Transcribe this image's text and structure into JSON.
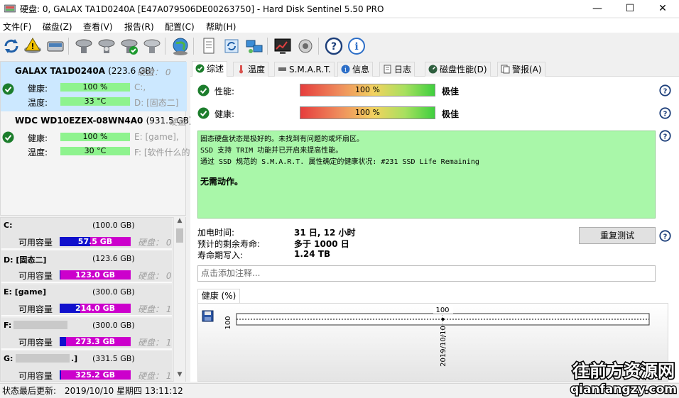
{
  "window": {
    "title": "硬盘:  0, GALAX TA1D0240A [E47A079506DE00263750]  -  Hard Disk Sentinel 5.50 PRO",
    "minimize": "—",
    "maximize": "☐",
    "close": "✕"
  },
  "menu": [
    "文件(F)",
    "磁盘(Z)",
    "查看(V)",
    "报告(R)",
    "配置(C)",
    "帮助(H)"
  ],
  "disks": [
    {
      "name": "GALAX TA1D0240A",
      "size": "(223.6 GB)",
      "hd_label": "硬盘：",
      "hd_index": "0",
      "health_label": "健康:",
      "health": "100 %",
      "health_pct": 100,
      "temp_label": "温度:",
      "temp": "33 °C",
      "drive_health": "C:,",
      "drive_temp": "D: [固态二]"
    },
    {
      "name": "WDC WD10EZEX-08WN4A0",
      "size": "(931.5 GB)",
      "hd_label": "硬盘",
      "hd_index": "",
      "health_label": "健康:",
      "health": "100 %",
      "health_pct": 100,
      "temp_label": "温度:",
      "temp": "30 °C",
      "drive_health": "E: [game],",
      "drive_temp": "F: [软件什么的"
    }
  ],
  "partitions": [
    {
      "letter": "C:",
      "size": "(100.0 GB)",
      "free_label": "可用容量",
      "free": "57.5 GB",
      "used_fraction": 0.43,
      "hd": "硬盘：",
      "hd_index": "0"
    },
    {
      "letter": "D: [固态二]",
      "size": "(123.6 GB)",
      "free_label": "可用容量",
      "free": "123.0 GB",
      "used_fraction": 0.005,
      "hd": "硬盘：",
      "hd_index": "0"
    },
    {
      "letter": "E: [game]",
      "size": "(300.0 GB)",
      "free_label": "可用容量",
      "free": "214.0 GB",
      "used_fraction": 0.29,
      "hd": "硬盘：",
      "hd_index": "1"
    },
    {
      "letter": "F: [",
      "size": "(300.0 GB)",
      "free_label": "可用容量",
      "free": "273.3 GB",
      "used_fraction": 0.09,
      "hd": "硬盘：",
      "hd_index": "1"
    },
    {
      "letter": "G: [",
      "letter_end": ".]",
      "size": "(331.5 GB)",
      "free_label": "可用容量",
      "free": "325.2 GB",
      "used_fraction": 0.02,
      "hd": "硬盘：",
      "hd_index": "1"
    }
  ],
  "tabs": [
    "综述",
    "温度",
    "S.M.A.R.T.",
    "信息",
    "日志",
    "磁盘性能(D)",
    "警报(A)"
  ],
  "overview": {
    "performance_label": "性能:",
    "performance": "100 %",
    "performance_pct": 100,
    "performance_rating": "极佳",
    "health_label": "健康:",
    "health": "100 %",
    "health_pct": 100,
    "health_rating": "极佳",
    "status_lines": [
      "固态硬盘状态是极好的。未找到有问题的或坏扇区。",
      "SSD 支持 TRIM 功能并已开启来提高性能。",
      "通过 SSD 规范的 S.M.A.R.T. 属性确定的健康状况:   #231 SSD Life Remaining"
    ],
    "status_action": "无需动作。",
    "power_on_label": "加电时间:",
    "power_on": "31 日, 12 小时",
    "remaining_label": "预计的剩余寿命:",
    "remaining": "多于 1000 日",
    "lifetime_writes_label": "寿命期写入:",
    "lifetime_writes": "1.24 TB",
    "retest_button": "重复测试",
    "note_placeholder": "点击添加注释..."
  },
  "chart_data": {
    "type": "line",
    "tab_label": "健康 (%)",
    "x": [
      "2019/10/10"
    ],
    "series": [
      {
        "values": [
          100
        ]
      }
    ],
    "y_tick_label": "100",
    "data_label": "100"
  },
  "statusbar": {
    "label": "状态最后更新:",
    "datetime": "2019/10/10 星期四 13:11:12"
  },
  "watermark": {
    "line1": "往前方资源网",
    "line2": "qianfangzy.com"
  },
  "colors": {
    "selected_disk": "#cce8ff",
    "health_green": "#8ef38e",
    "status_box": "#a9f7a9",
    "free_magenta": "#cc00cc",
    "used_blue": "#1010cc"
  }
}
